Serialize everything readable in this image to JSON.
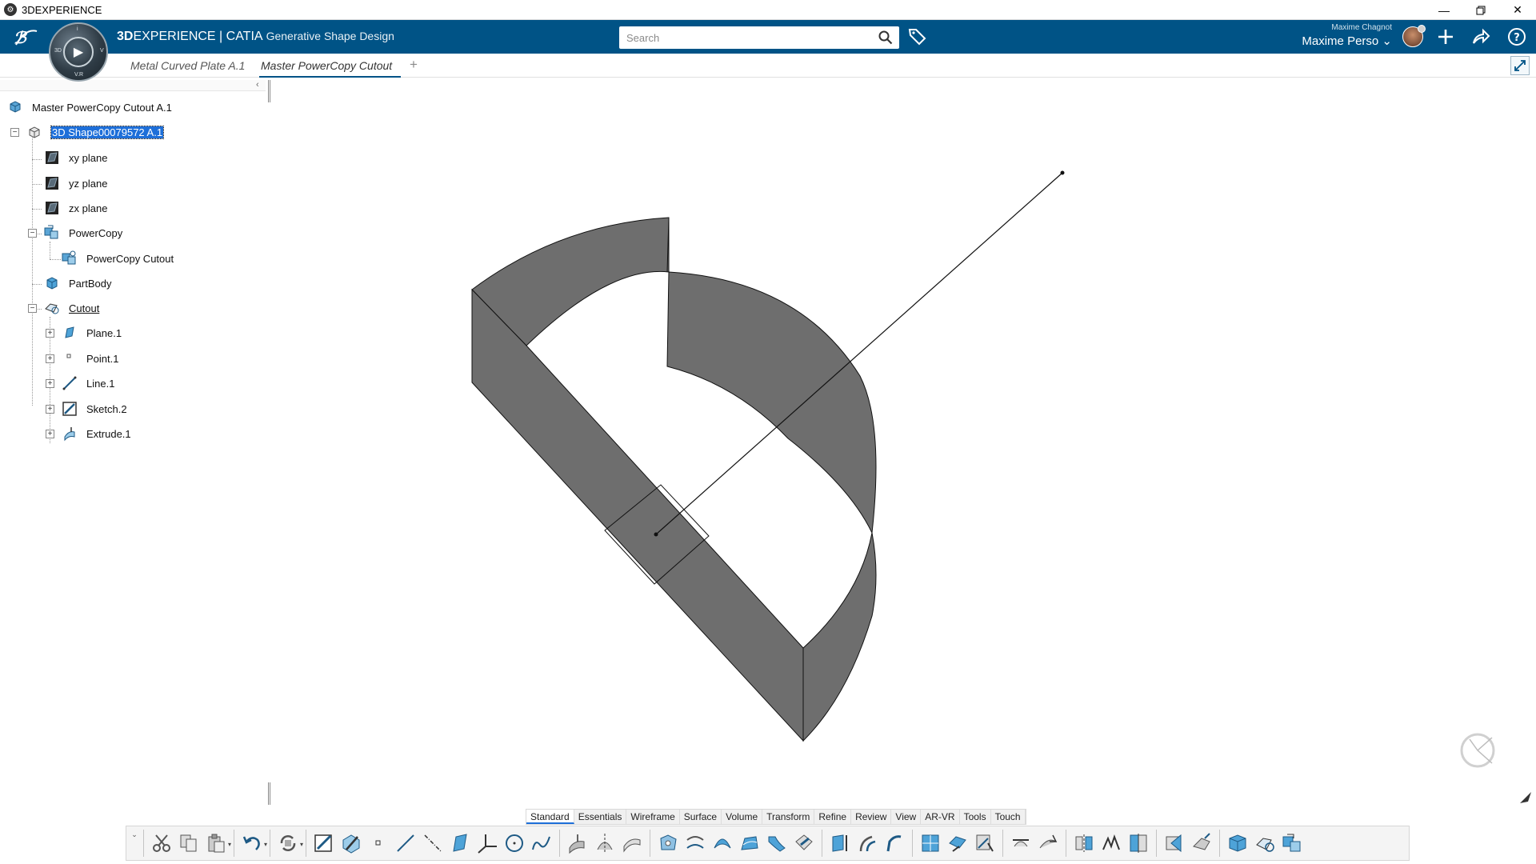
{
  "window": {
    "title": "3DEXPERIENCE",
    "controls": [
      "minimize",
      "restore",
      "close"
    ]
  },
  "topbar": {
    "brand_bold": "3D",
    "brand_rest": "EXPERIENCE | CATIA",
    "app_name": "Generative Shape Design",
    "search_placeholder": "Search",
    "user_small": "Maxime Chagnot",
    "user_name": "Maxime Perso",
    "compass_labels": {
      "left": "3D",
      "top": "i",
      "right": "V",
      "bottom": "V.R"
    }
  },
  "tabs": [
    {
      "label": "Metal Curved Plate A.1",
      "active": false
    },
    {
      "label": "Master PowerCopy Cutout",
      "active": true
    }
  ],
  "tab_add": "+",
  "tree": {
    "collapse": "‹",
    "root": "Master PowerCopy Cutout A.1",
    "items": [
      {
        "label": "3D Shape00079572 A.1",
        "icon": "3d-shape-icon",
        "selected": true
      },
      {
        "label": "xy plane",
        "icon": "plane-icon"
      },
      {
        "label": "yz plane",
        "icon": "plane-icon"
      },
      {
        "label": "zx plane",
        "icon": "plane-icon"
      },
      {
        "label": "PowerCopy",
        "icon": "powercopy-set-icon"
      },
      {
        "label": "PowerCopy Cutout",
        "icon": "powercopy-icon"
      },
      {
        "label": "PartBody",
        "icon": "partbody-icon"
      },
      {
        "label": "Cutout",
        "icon": "geometrical-set-icon",
        "underlined": true
      },
      {
        "label": "Plane.1",
        "icon": "plane-feature-icon"
      },
      {
        "label": "Point.1",
        "icon": "point-icon"
      },
      {
        "label": "Line.1",
        "icon": "line-icon"
      },
      {
        "label": "Sketch.2",
        "icon": "sketch-icon"
      },
      {
        "label": "Extrude.1",
        "icon": "extrude-icon"
      }
    ]
  },
  "section_tabs": [
    "Standard",
    "Essentials",
    "Wireframe",
    "Surface",
    "Volume",
    "Transform",
    "Refine",
    "Review",
    "View",
    "AR-VR",
    "Tools",
    "Touch"
  ],
  "active_section": "Standard",
  "colors": {
    "topbar": "#005386",
    "accent": "#1e6fd9",
    "shape_fill": "#6e6e6e",
    "selection": "#1e6fd9"
  },
  "action_bar_tools": [
    "cut-icon",
    "copy-icon",
    "paste-icon",
    "undo-icon",
    "update-icon",
    "sketch-tool-icon",
    "positioned-sketch-icon",
    "point-tool-icon",
    "line-tool-icon",
    "axis-tool-icon",
    "plane-tool-icon",
    "axis-system-icon",
    "circle-tool-icon",
    "spline-tool-icon",
    "extrude-surface-icon",
    "revolve-surface-icon",
    "sweep-icon",
    "fill-icon",
    "offset-icon",
    "sweep-surface-icon",
    "multi-section-icon",
    "blend-icon",
    "fillet-surface-icon",
    "split-icon",
    "trim-icon",
    "join-icon",
    "healing-icon",
    "extract-icon",
    "boundary-icon",
    "translate-icon",
    "rotate-icon",
    "symmetry-icon",
    "scaling-icon",
    "affinity-icon",
    "extrapolate-icon",
    "thickness-icon",
    "close-surface-icon",
    "partbody-tool-icon",
    "geometrical-set-tool-icon",
    "powercopy-tool-icon"
  ]
}
